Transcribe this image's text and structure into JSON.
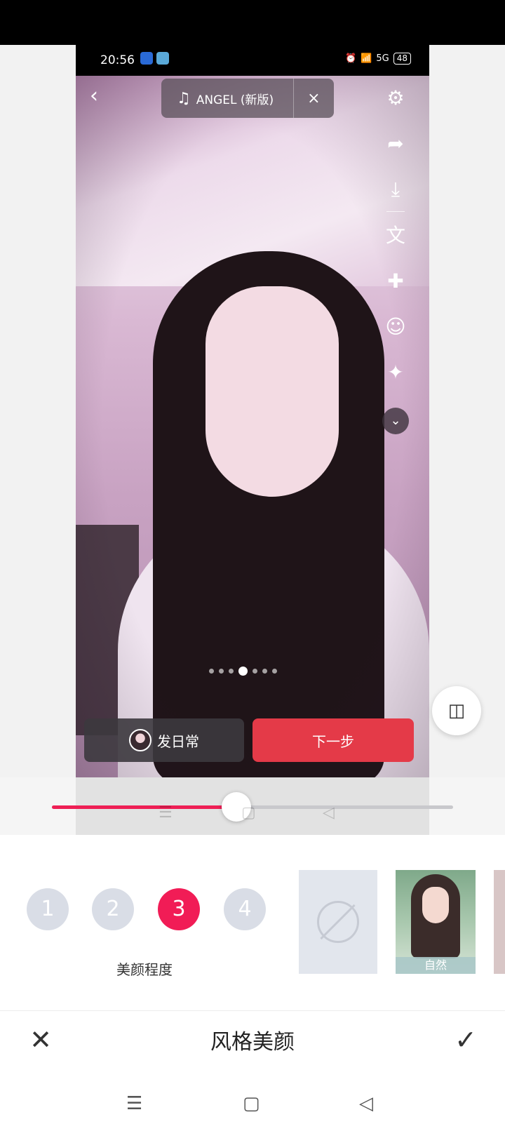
{
  "status": {
    "time": "20:56",
    "battery": "48",
    "network": "5G"
  },
  "music": {
    "title": "ANGEL (新版)",
    "close": "×"
  },
  "tools": [
    {
      "name": "settings-icon",
      "glyph": "⚙"
    },
    {
      "name": "share-icon",
      "glyph": "➦"
    },
    {
      "name": "download-icon",
      "glyph": "⤓"
    },
    {
      "name": "text-icon",
      "glyph": "文"
    },
    {
      "name": "sticker-add-icon",
      "glyph": "✚"
    },
    {
      "name": "sticker-icon",
      "glyph": "☺"
    },
    {
      "name": "effects-icon",
      "glyph": "✦"
    }
  ],
  "actions": {
    "daily": "发日常",
    "next": "下一步"
  },
  "slider": {
    "value": 0.46
  },
  "beauty": {
    "levels": [
      "1",
      "2",
      "3",
      "4"
    ],
    "active_level": "3",
    "label": "美颜程度"
  },
  "styles": {
    "natural": "自然"
  },
  "panel": {
    "title": "风格美颜"
  },
  "colors": {
    "accent": "#f11c56",
    "next_button": "#e43a48"
  }
}
